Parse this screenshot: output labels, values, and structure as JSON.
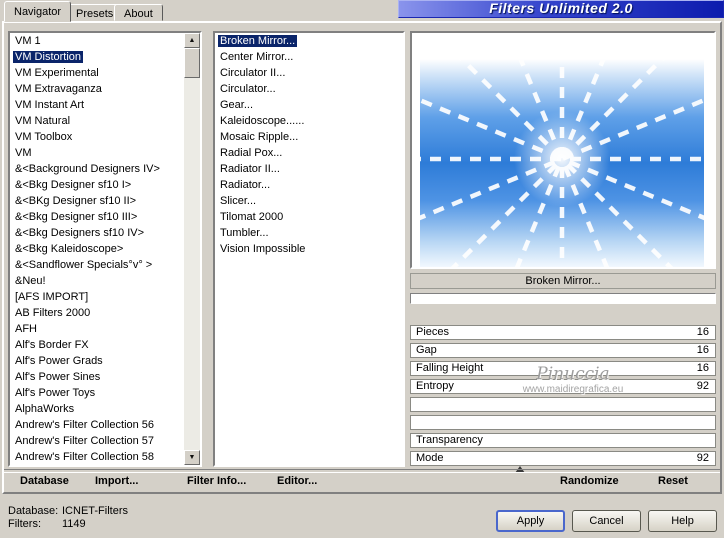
{
  "window": {
    "title": "Filters Unlimited 2.0"
  },
  "tabs": [
    {
      "label": "Navigator",
      "active": true
    },
    {
      "label": "Presets",
      "active": false
    },
    {
      "label": "About",
      "active": false
    }
  ],
  "icons": {
    "scroll_up": "▲",
    "scroll_down": "▼"
  },
  "categories": {
    "selected_index": 1,
    "items": [
      "VM 1",
      "VM Distortion",
      "VM Experimental",
      "VM Extravaganza",
      "VM Instant Art",
      "VM Natural",
      "VM Toolbox",
      "VM",
      "&<Background Designers IV>",
      "&<Bkg Designer sf10 I>",
      "&<BKg Designer sf10 II>",
      "&<Bkg Designer sf10 III>",
      "&<Bkg Designers sf10 IV>",
      "&<Bkg Kaleidoscope>",
      "&<Sandflower Specials°v° >",
      "&Neu!",
      "[AFS IMPORT]",
      "AB Filters 2000",
      "AFH",
      "Alf's Border FX",
      "Alf's Power Grads",
      "Alf's Power Sines",
      "Alf's Power Toys",
      "AlphaWorks",
      "Andrew's Filter Collection 56",
      "Andrew's Filter Collection 57",
      "Andrew's Filter Collection 58"
    ]
  },
  "filters": {
    "selected_index": 0,
    "items": [
      "Broken Mirror...",
      "Center Mirror...",
      "Circulator II...",
      "Circulator...",
      "Gear...",
      "Kaleidoscope......",
      "Mosaic Ripple...",
      "Radial Pox...",
      "Radiator II...",
      "Radiator...",
      "Slicer...",
      "Tilomat 2000",
      "Tumbler...",
      "Vision Impossible"
    ]
  },
  "preview": {
    "caption": "Broken Mirror..."
  },
  "watermark": {
    "line1": "Pinuccia",
    "line2": "www.maidiregrafica.eu"
  },
  "params": [
    {
      "label": "Pieces",
      "value": "16"
    },
    {
      "label": "Gap",
      "value": "16"
    },
    {
      "label": "Falling Height",
      "value": "16"
    },
    {
      "label": "Entropy",
      "value": "92"
    },
    {
      "label": "Transparency",
      "value": ""
    },
    {
      "label": "Mode",
      "value": "92"
    }
  ],
  "toolbar": [
    {
      "label": "Database"
    },
    {
      "label": "Import..."
    },
    {
      "label": "Filter Info..."
    },
    {
      "label": "Editor..."
    },
    {
      "label": "Randomize"
    },
    {
      "label": "Reset"
    }
  ],
  "status": {
    "database_label": "Database:",
    "database_value": "ICNET-Filters",
    "filters_label": "Filters:",
    "filters_value": "1149"
  },
  "actions": [
    {
      "label": "Apply",
      "default": true
    },
    {
      "label": "Cancel",
      "default": false
    },
    {
      "label": "Help",
      "default": false
    }
  ],
  "colors": {
    "chrome": "#d4d0c8",
    "selection": "#0a246a",
    "banner_start": "#8a94ec",
    "banner_end": "#0d1cae"
  }
}
